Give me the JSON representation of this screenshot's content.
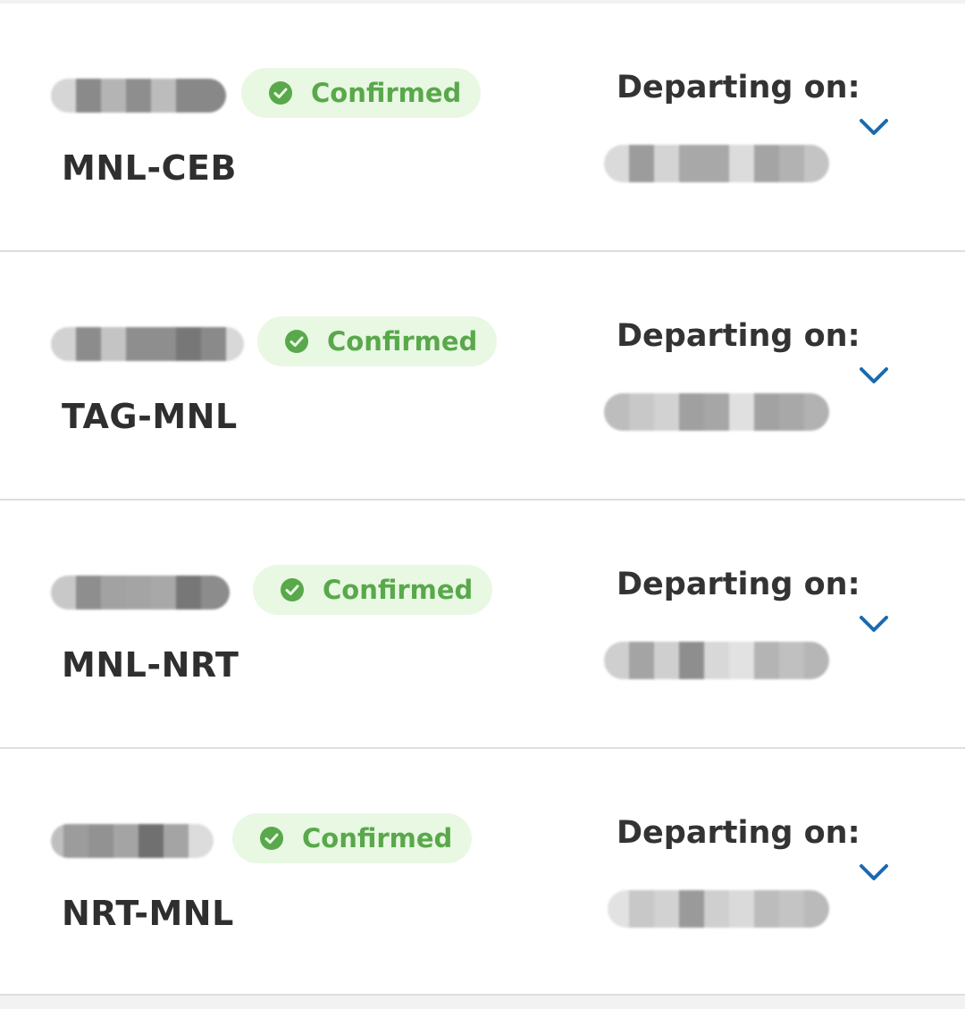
{
  "colors": {
    "accent_blue": "#1a6ab0",
    "confirmed_green": "#59a84b",
    "confirmed_bg": "#e8f8e3"
  },
  "bookings": [
    {
      "route": "MNL-CEB",
      "status": "Confirmed",
      "departing_label": "Departing on:",
      "expand_icon": "chevron-down-icon"
    },
    {
      "route": "TAG-MNL",
      "status": "Confirmed",
      "departing_label": "Departing on:",
      "expand_icon": "chevron-down-icon"
    },
    {
      "route": "MNL-NRT",
      "status": "Confirmed",
      "departing_label": "Departing on:",
      "expand_icon": "chevron-down-icon"
    },
    {
      "route": "NRT-MNL",
      "status": "Confirmed",
      "departing_label": "Departing on:",
      "expand_icon": "chevron-down-icon"
    }
  ]
}
